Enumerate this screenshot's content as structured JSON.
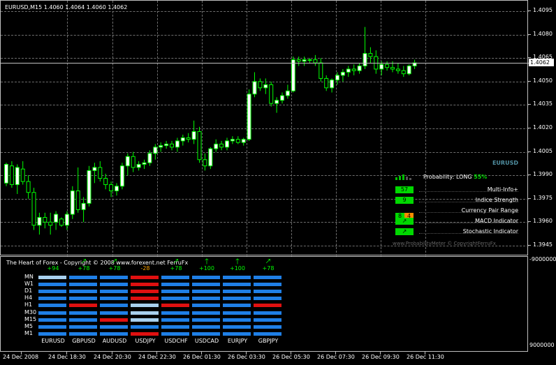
{
  "chart": {
    "title": "EURUSD,M15  1.4060 1.4064 1.4060 1.4062",
    "current_price": "1.4062",
    "price_axis": [
      "1.4095",
      "1.4080",
      "1.4065",
      "1.4050",
      "1.4035",
      "1.4020",
      "1.4005",
      "1.3990",
      "1.3975",
      "1.3960",
      "1.3945"
    ],
    "time_axis": [
      "24 Dec 2008",
      "24 Dec 18:30",
      "24 Dec 20:30",
      "24 Dec 22:30",
      "26 Dec 01:30",
      "26 Dec 03:30",
      "26 Dec 05:30",
      "26 Dec 07:30",
      "26 Dec 09:30",
      "26 Dec 11:30"
    ],
    "colors": {
      "bull": "#ffffff",
      "bear": "#000000",
      "wick": "#00ff00",
      "grid": "#6e6e6e"
    }
  },
  "chart_data": {
    "type": "candlestick",
    "ylim": [
      1.394,
      1.41
    ],
    "candles": [
      [
        1.3985,
        1.3998,
        1.3983,
        1.3997
      ],
      [
        1.3996,
        1.3999,
        1.3982,
        1.3984
      ],
      [
        1.3984,
        1.3997,
        1.3978,
        1.3995
      ],
      [
        1.3994,
        1.3999,
        1.3984,
        1.3986
      ],
      [
        1.3986,
        1.399,
        1.3975,
        1.3979
      ],
      [
        1.3979,
        1.3982,
        1.3955,
        1.3958
      ],
      [
        1.3958,
        1.3966,
        1.3952,
        1.3963
      ],
      [
        1.3963,
        1.3966,
        1.3956,
        1.396
      ],
      [
        1.396,
        1.3966,
        1.3952,
        1.3958
      ],
      [
        1.396,
        1.3967,
        1.3955,
        1.3965
      ],
      [
        1.3962,
        1.3963,
        1.3957,
        1.3958
      ],
      [
        1.3958,
        1.3967,
        1.3955,
        1.3965
      ],
      [
        1.3965,
        1.3983,
        1.3962,
        1.398
      ],
      [
        1.398,
        1.3995,
        1.3966,
        1.3968
      ],
      [
        1.3968,
        1.3976,
        1.396,
        1.3972
      ],
      [
        1.3972,
        1.3996,
        1.397,
        1.3993
      ],
      [
        1.3993,
        1.3998,
        1.3985,
        1.3995
      ],
      [
        1.3995,
        1.3999,
        1.3986,
        1.3988
      ],
      [
        1.3988,
        1.3991,
        1.3981,
        1.3984
      ],
      [
        1.3984,
        1.3986,
        1.3976,
        1.398
      ],
      [
        1.398,
        1.3985,
        1.3977,
        1.3983
      ],
      [
        1.3983,
        1.3998,
        1.3981,
        1.3996
      ],
      [
        1.3996,
        1.4004,
        1.399,
        1.4002
      ],
      [
        1.4002,
        1.4005,
        1.3992,
        1.3995
      ],
      [
        1.3995,
        1.3999,
        1.3993,
        1.3997
      ],
      [
        1.3997,
        1.4,
        1.3994,
        1.3998
      ],
      [
        1.3998,
        1.4006,
        1.3996,
        1.4004
      ],
      [
        1.4004,
        1.401,
        1.4,
        1.4008
      ],
      [
        1.4008,
        1.4011,
        1.4005,
        1.4009
      ],
      [
        1.4009,
        1.4012,
        1.4007,
        1.401
      ],
      [
        1.401,
        1.4012,
        1.4006,
        1.4008
      ],
      [
        1.4008,
        1.4014,
        1.4005,
        1.4012
      ],
      [
        1.4012,
        1.4016,
        1.4009,
        1.4014
      ],
      [
        1.4014,
        1.4017,
        1.4011,
        1.4013
      ],
      [
        1.4013,
        1.4025,
        1.401,
        1.4018
      ],
      [
        1.4018,
        1.4021,
        1.3998,
        1.4
      ],
      [
        1.4,
        1.4004,
        1.3993,
        1.3996
      ],
      [
        1.3996,
        1.4008,
        1.3994,
        1.4007
      ],
      [
        1.4007,
        1.4013,
        1.4005,
        1.401
      ],
      [
        1.401,
        1.4012,
        1.4006,
        1.4008
      ],
      [
        1.4008,
        1.4014,
        1.4006,
        1.4012
      ],
      [
        1.4012,
        1.4015,
        1.401,
        1.4013
      ],
      [
        1.4013,
        1.4015,
        1.401,
        1.4011
      ],
      [
        1.4011,
        1.4014,
        1.4009,
        1.4013
      ],
      [
        1.4013,
        1.4045,
        1.4012,
        1.4042
      ],
      [
        1.4042,
        1.4056,
        1.404,
        1.405
      ],
      [
        1.405,
        1.4052,
        1.4044,
        1.4046
      ],
      [
        1.4046,
        1.4052,
        1.4042,
        1.4048
      ],
      [
        1.4048,
        1.405,
        1.4034,
        1.4036
      ],
      [
        1.4036,
        1.404,
        1.403,
        1.4038
      ],
      [
        1.4038,
        1.4043,
        1.4036,
        1.4041
      ],
      [
        1.4041,
        1.4048,
        1.4039,
        1.4044
      ],
      [
        1.4044,
        1.4066,
        1.4043,
        1.4064
      ],
      [
        1.4064,
        1.4066,
        1.406,
        1.4063
      ],
      [
        1.4063,
        1.4066,
        1.406,
        1.4064
      ],
      [
        1.4064,
        1.4065,
        1.4062,
        1.4064
      ],
      [
        1.4064,
        1.4067,
        1.406,
        1.4062
      ],
      [
        1.4062,
        1.4065,
        1.405,
        1.4052
      ],
      [
        1.4052,
        1.4054,
        1.4044,
        1.4046
      ],
      [
        1.4046,
        1.4052,
        1.4043,
        1.4051
      ],
      [
        1.4051,
        1.4056,
        1.4048,
        1.4054
      ],
      [
        1.4054,
        1.4058,
        1.405,
        1.4056
      ],
      [
        1.4056,
        1.406,
        1.4053,
        1.4058
      ],
      [
        1.4058,
        1.4061,
        1.4054,
        1.4057
      ],
      [
        1.4057,
        1.4062,
        1.4055,
        1.406
      ],
      [
        1.406,
        1.4085,
        1.4058,
        1.4068
      ],
      [
        1.4068,
        1.4072,
        1.4062,
        1.4066
      ],
      [
        1.4066,
        1.407,
        1.4055,
        1.4058
      ],
      [
        1.4058,
        1.4063,
        1.4054,
        1.4061
      ],
      [
        1.4061,
        1.4063,
        1.4057,
        1.4059
      ],
      [
        1.4059,
        1.4063,
        1.4056,
        1.4058
      ],
      [
        1.4058,
        1.4062,
        1.4055,
        1.4057
      ],
      [
        1.4057,
        1.406,
        1.4053,
        1.4055
      ],
      [
        1.4055,
        1.4061,
        1.4054,
        1.406
      ],
      [
        1.406,
        1.4064,
        1.4058,
        1.4062
      ]
    ]
  },
  "indicator": {
    "title": "EURUSD",
    "probability_prefix": "Probability:",
    "probability_dir": "LONG",
    "probability_pct": "55%",
    "rows": [
      {
        "box": "57",
        "label": "Multi-Info+"
      },
      {
        "box": "9",
        "label": "Indice Strength"
      },
      {
        "box_a": "8",
        "box_b": "4",
        "label": "Currency Pair Range"
      },
      {
        "box": "↗",
        "label": "MACD Indicator"
      },
      {
        "box": "↗",
        "label": "Stochastic Indicator"
      }
    ],
    "footer": "www.ProbabilityMeter © CopyrightFerruFx"
  },
  "heart": {
    "title": "The Heart of Forex - Copyright © 2008 www.forexent.net FerruFx",
    "axis_top": "-9000000",
    "axis_bottom": "9000000",
    "timeframes": [
      "MN",
      "W1",
      "D1",
      "H4",
      "H1",
      "M30",
      "M15",
      "M5",
      "M1"
    ],
    "pairs": [
      {
        "name": "EURUSD",
        "score": "+94",
        "arrow": "",
        "colors": [
          "#a8d0ee",
          "#1f7fe6",
          "#1f7fe6",
          "#1f7fe6",
          "#1f7fe6",
          "#1f7fe6",
          "#1f7fe6",
          "#1f7fe6",
          "#1f7fe6"
        ]
      },
      {
        "name": "GBPUSD",
        "score": "+78",
        "arrow": "🡕",
        "colors": [
          "#1f7fe6",
          "#1f7fe6",
          "#1f7fe6",
          "#1f7fe6",
          "#e01010",
          "#1f7fe6",
          "#1f7fe6",
          "#1f7fe6",
          "#1f7fe6"
        ]
      },
      {
        "name": "AUDUSD",
        "score": "+78",
        "arrow": "🡕",
        "colors": [
          "#1f7fe6",
          "#1f7fe6",
          "#1f7fe6",
          "#1f7fe6",
          "#1f7fe6",
          "#1f7fe6",
          "#e01010",
          "#1f7fe6",
          "#1f7fe6"
        ]
      },
      {
        "name": "USDJPY",
        "score": "-28",
        "arrow": "",
        "colors": [
          "#e01010",
          "#e01010",
          "#e01010",
          "#e01010",
          "#a8d0ee",
          "#a8d0ee",
          "#a8d0ee",
          "#1f7fe6",
          "#e01010"
        ]
      },
      {
        "name": "USDCHF",
        "score": "+78",
        "arrow": "🡕",
        "colors": [
          "#1f7fe6",
          "#1f7fe6",
          "#1f7fe6",
          "#1f7fe6",
          "#e01010",
          "#1f7fe6",
          "#1f7fe6",
          "#1f7fe6",
          "#1f7fe6"
        ]
      },
      {
        "name": "USDCAD",
        "score": "+100",
        "arrow": "🡑",
        "colors": [
          "#1f7fe6",
          "#1f7fe6",
          "#1f7fe6",
          "#1f7fe6",
          "#1f7fe6",
          "#1f7fe6",
          "#1f7fe6",
          "#1f7fe6",
          "#1f7fe6"
        ]
      },
      {
        "name": "EURJPY",
        "score": "+100",
        "arrow": "🡑",
        "colors": [
          "#1f7fe6",
          "#1f7fe6",
          "#1f7fe6",
          "#1f7fe6",
          "#1f7fe6",
          "#1f7fe6",
          "#1f7fe6",
          "#1f7fe6",
          "#1f7fe6"
        ]
      },
      {
        "name": "GBPJPY",
        "score": "+78",
        "arrow": "🡕",
        "colors": [
          "#1f7fe6",
          "#1f7fe6",
          "#1f7fe6",
          "#1f7fe6",
          "#e01010",
          "#1f7fe6",
          "#1f7fe6",
          "#1f7fe6",
          "#1f7fe6"
        ]
      }
    ]
  }
}
